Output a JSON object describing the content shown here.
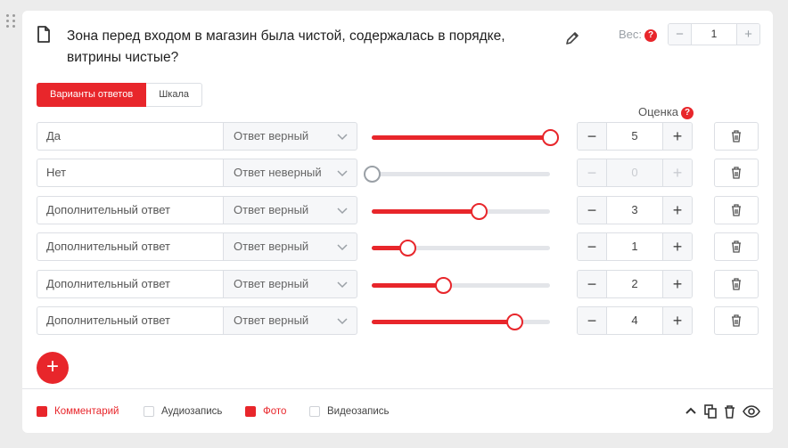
{
  "question": {
    "title": "Зона перед входом в магазин была чистой, содержалась в порядке, витрины чистые?",
    "weight_label": "Вес:",
    "weight_help": "?",
    "weight_value": "1",
    "minus": "−",
    "plus": "+"
  },
  "tabs": [
    {
      "label": "Варианты ответов",
      "active": true
    },
    {
      "label": "Шкала",
      "active": false
    }
  ],
  "score_header": "Оценка",
  "score_help": "?",
  "answers": [
    {
      "label": "Да",
      "type": "Ответ верный",
      "score": "5",
      "slider": 1.0
    },
    {
      "label": "Нет",
      "type": "Ответ неверный",
      "score": "0",
      "slider": 0.0,
      "disabled": true
    },
    {
      "label": "Дополнительный ответ",
      "type": "Ответ верный",
      "score": "3",
      "slider": 0.6
    },
    {
      "label": "Дополнительный ответ",
      "type": "Ответ верный",
      "score": "1",
      "slider": 0.2
    },
    {
      "label": "Дополнительный ответ",
      "type": "Ответ верный",
      "score": "2",
      "slider": 0.4
    },
    {
      "label": "Дополнительный ответ",
      "type": "Ответ верный",
      "score": "4",
      "slider": 0.8
    }
  ],
  "add_button": "+",
  "footer": {
    "options": [
      {
        "label": "Комментарий",
        "checked": true
      },
      {
        "label": "Аудиозапись",
        "checked": false
      },
      {
        "label": "Фото",
        "checked": true
      },
      {
        "label": "Видеозапись",
        "checked": false
      }
    ]
  },
  "colors": {
    "accent": "#e8262b",
    "border": "#dcdfe4",
    "muted": "#9aa0a6"
  }
}
